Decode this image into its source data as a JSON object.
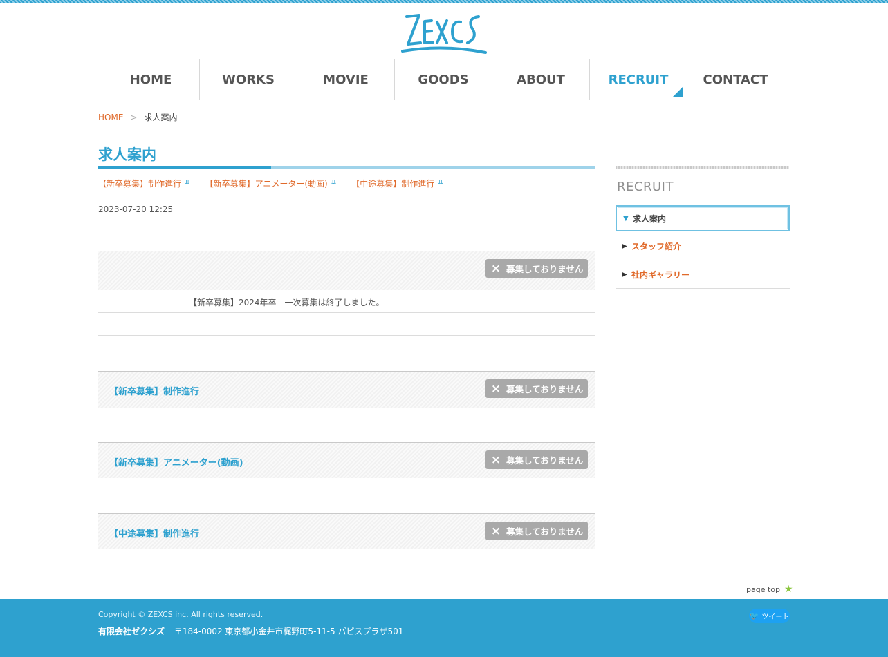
{
  "header": {
    "logo_text": "ZEXCS",
    "nav": [
      {
        "label": "HOME"
      },
      {
        "label": "WORKS"
      },
      {
        "label": "MOVIE"
      },
      {
        "label": "GOODS"
      },
      {
        "label": "ABOUT"
      },
      {
        "label": "RECRUIT"
      },
      {
        "label": "CONTACT"
      }
    ],
    "active_nav": "RECRUIT"
  },
  "breadcrumb": {
    "home": "HOME",
    "separator": ">",
    "current": "求人案内"
  },
  "main": {
    "title": "求人案内",
    "anchors": [
      {
        "label": "【新卒募集】制作進行",
        "icon": "double-down-arrow-icon"
      },
      {
        "label": "【新卒募集】アニメーター(動画)",
        "icon": "double-down-arrow-icon"
      },
      {
        "label": "【中途募集】制作進行",
        "icon": "double-down-arrow-icon"
      }
    ],
    "date": "2023-07-20 12:25",
    "notice": "【新卒募集】2024年卒　一次募集は終了しました。",
    "status_label": "募集しておりません",
    "status_icon": "×",
    "sections": [
      {
        "title": "【新卒募集】制作進行"
      },
      {
        "title": "【新卒募集】アニメーター(動画)"
      },
      {
        "title": "【中途募集】制作進行"
      }
    ]
  },
  "sidebar": {
    "heading": "RECRUIT",
    "items": [
      {
        "label": "求人案内",
        "active": true
      },
      {
        "label": "スタッフ紹介",
        "active": false
      },
      {
        "label": "社内ギャラリー",
        "active": false
      }
    ]
  },
  "page_top": {
    "label": "page top",
    "icon": "★"
  },
  "footer": {
    "copyright": "Copyright © ZEXCS inc. All rights reserved.",
    "company": "有限会社ゼクシズ",
    "address": "〒184-0002 東京都小金井市梶野町5-11-5 パピスプラザ501",
    "tweet_label": "ツイート"
  },
  "colors": {
    "accent": "#2ea1cf",
    "link": "#e06a2b",
    "badge": "#a9a9a9",
    "page_top_star": "#8cc63f"
  }
}
